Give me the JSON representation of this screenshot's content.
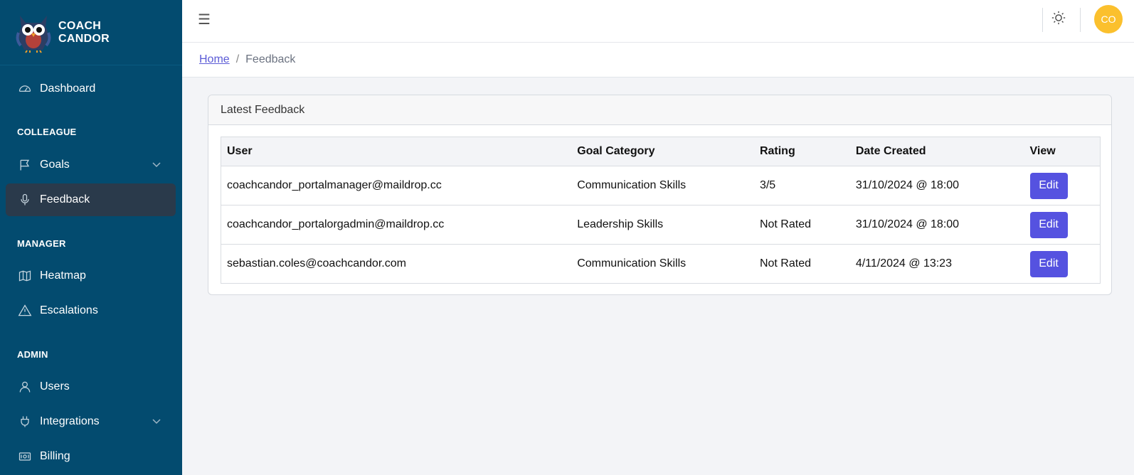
{
  "brand": {
    "line1": "COACH",
    "line2": "CANDOR"
  },
  "sidebar": {
    "dashboard": "Dashboard",
    "sections": {
      "colleague": "COLLEAGUE",
      "manager": "MANAGER",
      "admin": "ADMIN"
    },
    "goals": "Goals",
    "feedback": "Feedback",
    "heatmap": "Heatmap",
    "escalations": "Escalations",
    "users": "Users",
    "integrations": "Integrations",
    "billing": "Billing"
  },
  "topbar": {
    "menu_icon": "☰",
    "avatar_initials": "CO"
  },
  "breadcrumb": {
    "home": "Home",
    "separator": "/",
    "current": "Feedback"
  },
  "card": {
    "title": "Latest Feedback",
    "columns": [
      "User",
      "Goal Category",
      "Rating",
      "Date Created",
      "View"
    ],
    "rows": [
      {
        "user": "coachcandor_portalmanager@maildrop.cc",
        "category": "Communication Skills",
        "rating": "3/5",
        "date": "31/10/2024 @ 18:00",
        "action": "Edit"
      },
      {
        "user": "coachcandor_portalorgadmin@maildrop.cc",
        "category": "Leadership Skills",
        "rating": "Not Rated",
        "date": "31/10/2024 @ 18:00",
        "action": "Edit"
      },
      {
        "user": "sebastian.coles@coachcandor.com",
        "category": "Communication Skills",
        "rating": "Not Rated",
        "date": "4/11/2024 @ 13:23",
        "action": "Edit"
      }
    ]
  },
  "colors": {
    "sidebar_bg": "#034b6f",
    "active_item_bg": "#2a3a4b",
    "accent": "#5552e0",
    "avatar_bg": "#fbc02d"
  }
}
